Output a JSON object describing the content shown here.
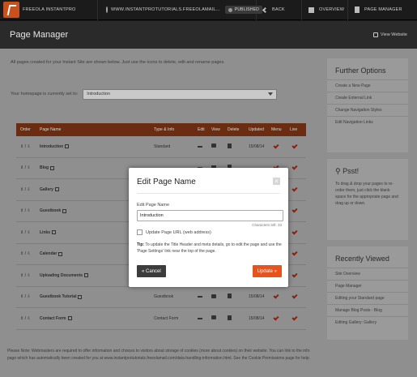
{
  "topbar": {
    "brand": "FREEOLA INSTANTPRO",
    "site_url": "WWW.INSTANTPROTUTORIALS.FREEOLAMAIL...",
    "published": "PUBLISHED",
    "back": "BACK",
    "overview": "OVERVIEW",
    "page_manager": "PAGE MANAGER"
  },
  "header": {
    "title": "Page Manager",
    "view_website": "View Website"
  },
  "intro": "All pages created for your Instant Site are shown below. Just use the icons to delete, edit and rename pages.",
  "homepage": {
    "label": "Your homepage is currently set to:",
    "value": "Introduction"
  },
  "table": {
    "headers": [
      "Order",
      "Page Name",
      "Type & Info",
      "Edit",
      "View",
      "Delete",
      "Updated",
      "Menu",
      "Live"
    ],
    "order_glyph": "⇕ / ⇩",
    "rows": [
      {
        "name": "Introduction",
        "type": "Standard",
        "updated": "15/08/14"
      },
      {
        "name": "Blog",
        "type": "",
        "updated": ""
      },
      {
        "name": "Gallery",
        "type": "",
        "updated": ""
      },
      {
        "name": "Guestbook",
        "type": "",
        "updated": ""
      },
      {
        "name": "Links",
        "type": "",
        "updated": ""
      },
      {
        "name": "Calendar",
        "type": "",
        "updated": ""
      },
      {
        "name": "Uploading Documents",
        "type": "",
        "updated": ""
      },
      {
        "name": "Guestbook Tutorial",
        "type": "Guestbook",
        "updated": "15/08/14"
      },
      {
        "name": "Contact Form",
        "type": "Contact Form",
        "updated": "15/08/14"
      }
    ]
  },
  "footnote": "Please Note: Webmasters are required to offer information and choices to visitors about storage of cookies (more about cookies) on their website. You can link to the info page which has automatically been created for you at www.instantprotutorials.freeolamail.com/data-handling-information.html. See the Cookie Permissions page for help.",
  "sidebar": {
    "further_title": "Further Options",
    "further_items": [
      "Create a New Page",
      "Create External Link",
      "Change Navigation Styles",
      "Edit Navigation Links"
    ],
    "psst_title": "Psst!",
    "psst_text": "To drag & drop your pages to re-order them, just click the blank space for the appropriate page and drag up or down.",
    "recent_title": "Recently Viewed",
    "recent_items": [
      "Site Overview",
      "Page Manager",
      "Editing your Standard page",
      "Manage Blog Posts - Blog",
      "Editing Gallery: Gallery"
    ]
  },
  "modal": {
    "title": "Edit Page Name",
    "close": "×",
    "field_label": "Edit Page Name",
    "field_value": "Introduction",
    "chars_left": "Characters left: 33",
    "checkbox_label": "Update Page URL (web address)",
    "tip_label": "Tip:",
    "tip_text": "To update the Title Header and meta details, go to edit the page and use the 'Page Settings' link near the top of the page.",
    "cancel": "« Cancel",
    "update": "Update »"
  },
  "colors": {
    "accent": "#e8521e",
    "table_header": "#6a2d12",
    "dark": "#1b1b1b"
  }
}
